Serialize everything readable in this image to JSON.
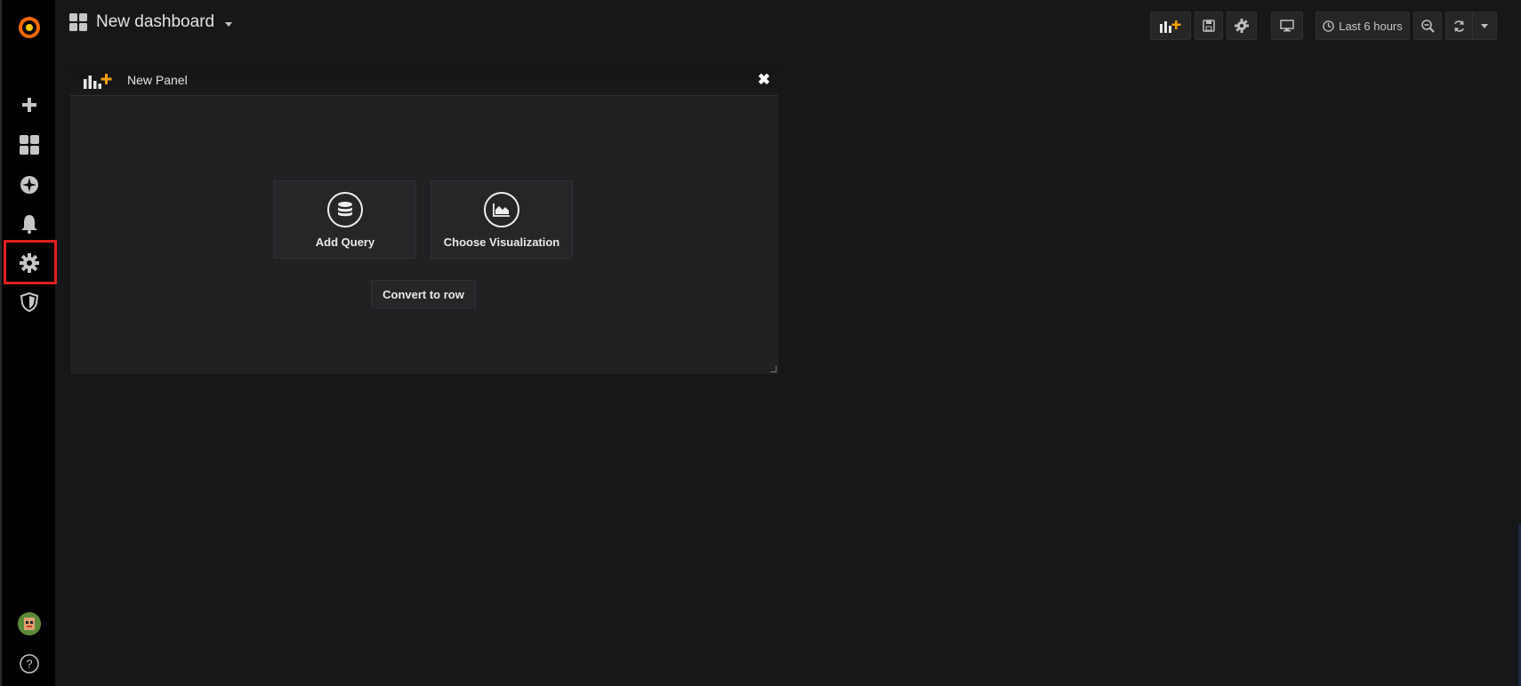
{
  "dashboard": {
    "title": "New dashboard"
  },
  "toolbar": {
    "add_panel_icon": "add-panel-icon",
    "save_icon": "save-icon",
    "settings_icon": "gear-icon",
    "tv_icon": "monitor-icon",
    "time_range_label": "Last 6 hours",
    "zoom_icon": "zoom-out-icon",
    "refresh_icon": "refresh-icon",
    "refresh_dropdown_icon": "caret-down-icon"
  },
  "sidebar": {
    "items": [
      {
        "name": "create",
        "icon": "plus-icon"
      },
      {
        "name": "dashboards",
        "icon": "dashboards-icon"
      },
      {
        "name": "explore",
        "icon": "compass-icon"
      },
      {
        "name": "alerting",
        "icon": "bell-icon"
      },
      {
        "name": "configuration",
        "icon": "gear-icon",
        "highlighted": true
      },
      {
        "name": "server-admin",
        "icon": "shield-icon"
      }
    ],
    "bottom": [
      {
        "name": "profile",
        "icon": "avatar"
      },
      {
        "name": "help",
        "icon": "help-icon"
      }
    ]
  },
  "panel": {
    "title": "New Panel",
    "add_query_label": "Add Query",
    "choose_visualization_label": "Choose Visualization",
    "convert_to_row_label": "Convert to row"
  },
  "colors": {
    "background": "#161719",
    "sidebar": "#000000",
    "panel": "#212124",
    "accent": "#f46800",
    "highlight": "#e02020"
  }
}
